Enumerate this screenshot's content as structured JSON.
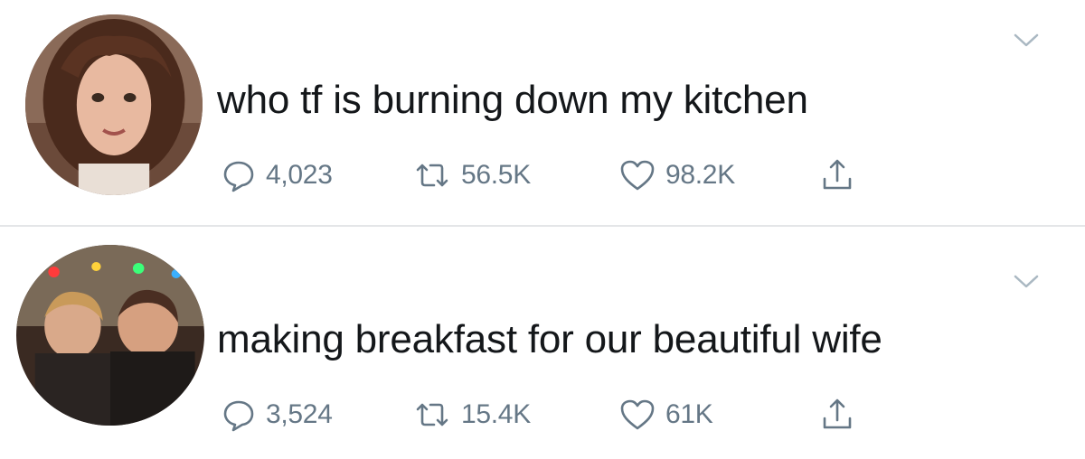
{
  "tweets": [
    {
      "text": "who tf is burning down my kitchen",
      "replies": "4,023",
      "retweets": "56.5K",
      "likes": "98.2K"
    },
    {
      "text": "making breakfast for our beautiful wife",
      "replies": "3,524",
      "retweets": "15.4K",
      "likes": "61K"
    }
  ],
  "icons": [
    "chevron-down-icon",
    "reply-icon",
    "retweet-icon",
    "like-icon",
    "share-icon"
  ],
  "colors": {
    "text": "#14171a",
    "muted": "#657786",
    "divider": "#e4e6e8"
  }
}
